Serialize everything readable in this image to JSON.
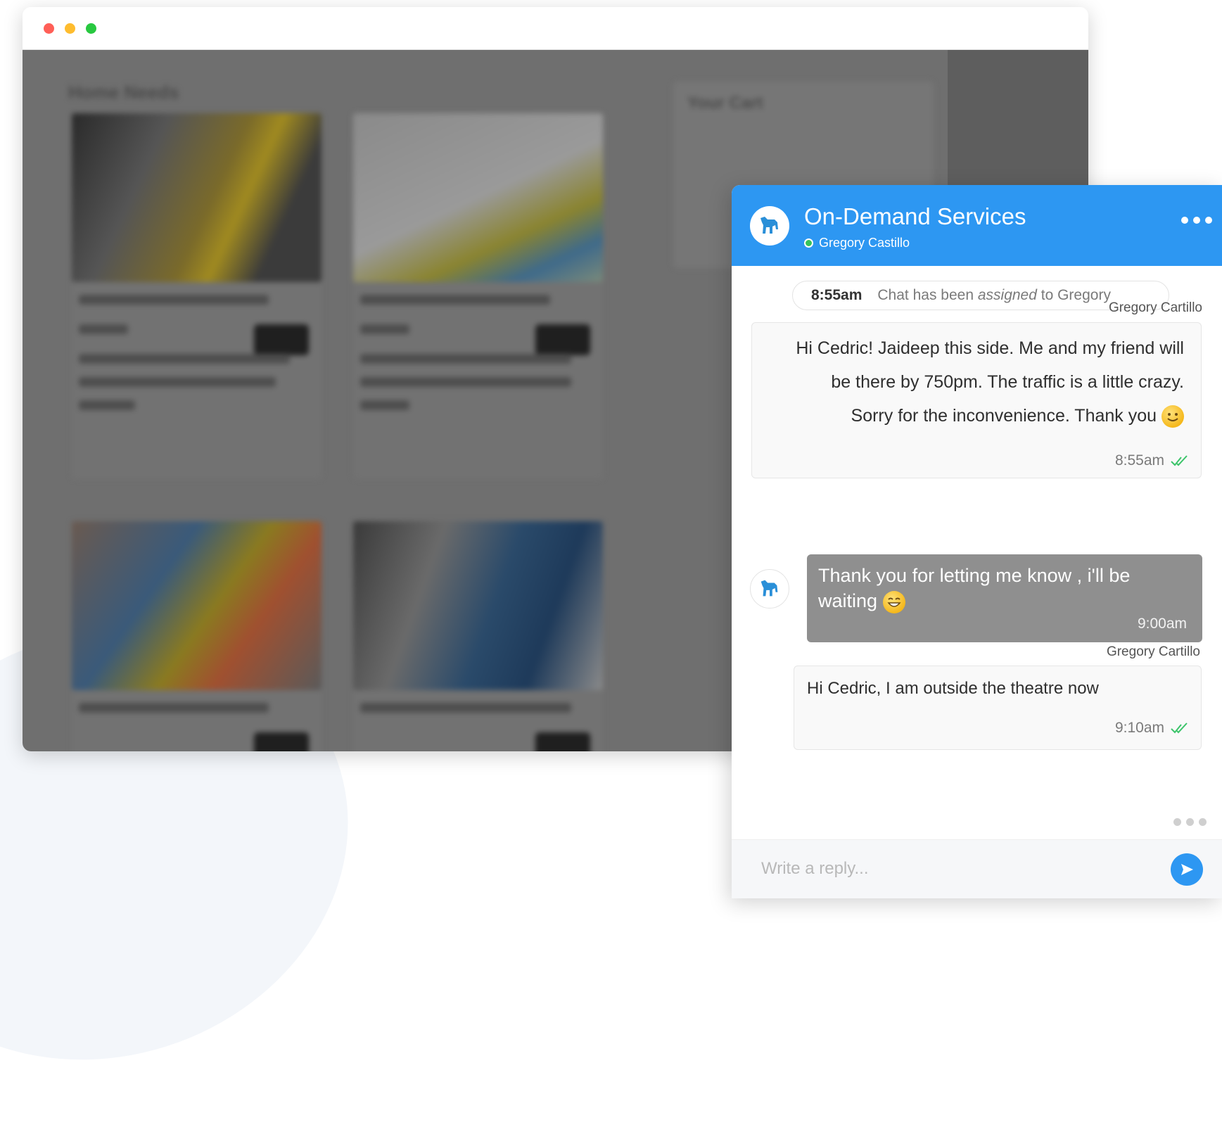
{
  "browser": {
    "page_heading": "Home Needs",
    "cart_title": "Your Cart"
  },
  "chat": {
    "title": "On-Demand Services",
    "agent_name": "Gregory Castillo",
    "agent_status_color": "#36c25a",
    "header_color": "#2d97f2",
    "system_message": {
      "time": "8:55am",
      "text_before": "Chat has been",
      "text_emphasis": "assigned",
      "text_after": "to Gregory"
    },
    "messages": [
      {
        "sender": "Gregory Cartillo",
        "lines": [
          "Hi Cedric! Jaideep this side. Me and my friend will",
          "be there by 750pm. The traffic is a little crazy.",
          "Sorry for the inconvenience. Thank you"
        ],
        "emoji": "slightly-smiling-face-emoji",
        "time": "8:55am",
        "status_icon": "double-check-icon"
      },
      {
        "from": "bot",
        "text": "Thank you for letting me know , i'll be waiting",
        "emoji": "grinning-face-emoji",
        "time": "9:00am"
      },
      {
        "sender": "Gregory Cartillo",
        "text": "Hi Cedric, I am outside the theatre now",
        "time": "9:10am",
        "status_icon": "double-check-icon"
      }
    ],
    "composer": {
      "placeholder": "Write a reply..."
    }
  }
}
